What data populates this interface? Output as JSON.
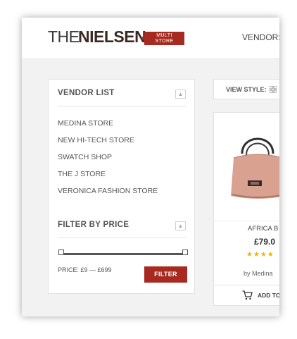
{
  "header": {
    "logo": {
      "word1": "THE",
      "word2": "NIELSEN",
      "badge_line1": "MULTI",
      "badge_line2": "STORE"
    },
    "nav": {
      "vendors": "VENDORS"
    }
  },
  "sidebar": {
    "vendor_list": {
      "title": "VENDOR LIST",
      "toggle_icon": "chevron-up-icon",
      "items": [
        {
          "label": "MEDINA STORE"
        },
        {
          "label": "NEW HI-TECH STORE"
        },
        {
          "label": "SWATCH SHOP"
        },
        {
          "label": "THE J STORE"
        },
        {
          "label": "VERONICA FASHION STORE"
        }
      ]
    },
    "filter_by_price": {
      "title": "FILTER BY PRICE",
      "toggle_icon": "chevron-up-icon",
      "range_min_fraction": 0,
      "range_max_fraction": 1,
      "price_label": "PRICE: £9 — £699",
      "button_label": "FILTER"
    }
  },
  "toolbar": {
    "view_style_label": "VIEW STYLE:",
    "view_icon": "grid-icon"
  },
  "product": {
    "name": "AFRICA B",
    "price": "£79.0",
    "rating_stars": 4,
    "stars_text": "★★★★",
    "vendor_text": "by Medina",
    "add_to_cart_label": "ADD TO",
    "image_icon": "handbag-image"
  },
  "colors": {
    "accent": "#a72a20",
    "star": "#f3b200",
    "background": "#f2f2f2"
  }
}
